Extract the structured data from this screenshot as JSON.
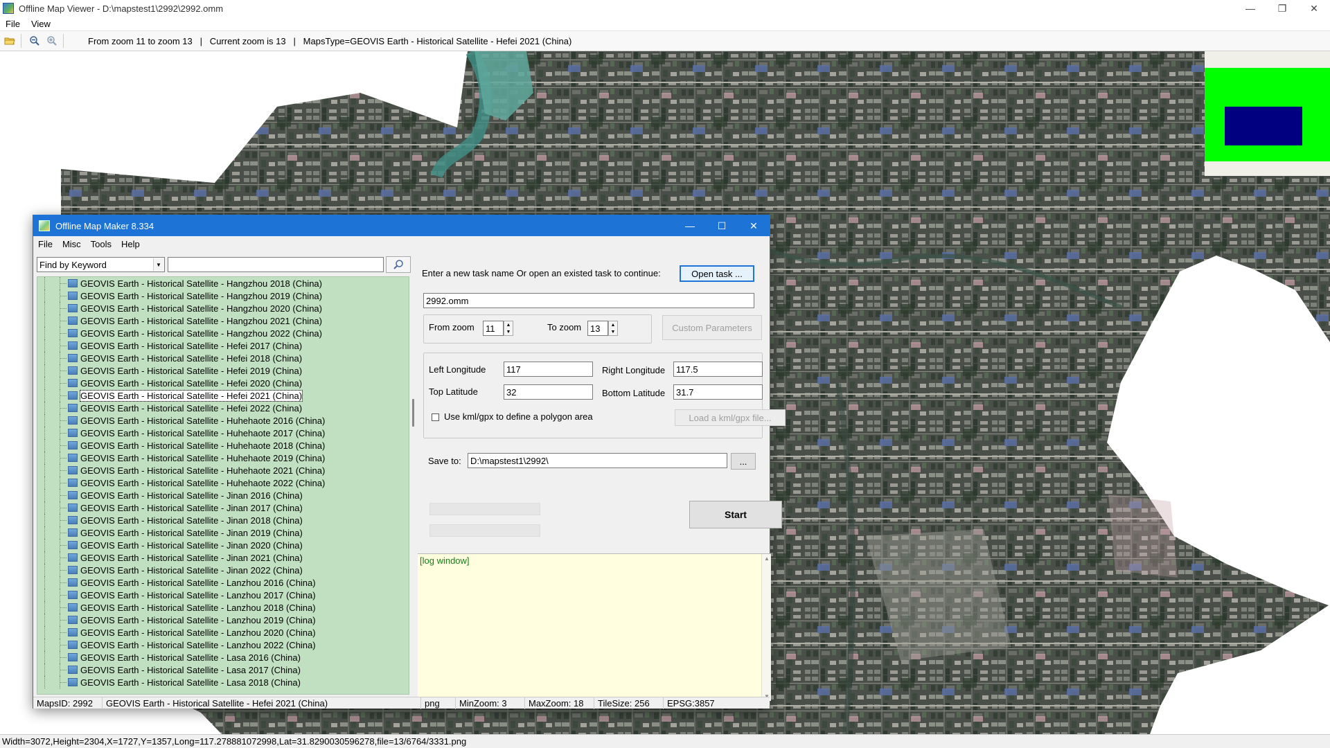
{
  "viewer": {
    "title": "Offline Map Viewer - D:\\mapstest1\\2992\\2992.omm",
    "window_controls": {
      "minimize": "—",
      "maximize": "❐",
      "close": "✕"
    },
    "menu": [
      "File",
      "View"
    ],
    "toolbar": {
      "status_text": "From zoom 11 to zoom 13   |   Current zoom is 13   |   MapsType=GEOVIS Earth - Historical Satellite - Hefei 2021 (China)",
      "icons": [
        "folder-open-icon",
        "zoom-out-icon",
        "zoom-in-icon"
      ]
    },
    "statusbar": "Width=3072,Height=2304,X=1727,Y=1357,Long=117.278881072998,Lat=31.8290030596278,file=13/6764/3331.png",
    "colors": {
      "overview_green": "#00ff00",
      "overview_blue": "#000080"
    }
  },
  "maker": {
    "title": "Offline Map Maker 8.334",
    "window_controls": {
      "minimize": "—",
      "maximize": "☐",
      "close": "✕"
    },
    "menu": [
      "File",
      "Misc",
      "Tools",
      "Help"
    ],
    "search": {
      "mode": "Find by Keyword",
      "query": ""
    },
    "tree_items": [
      "GEOVIS Earth - Historical Satellite - Hangzhou 2018 (China)",
      "GEOVIS Earth - Historical Satellite - Hangzhou 2019 (China)",
      "GEOVIS Earth - Historical Satellite - Hangzhou 2020 (China)",
      "GEOVIS Earth - Historical Satellite - Hangzhou 2021 (China)",
      "GEOVIS Earth - Historical Satellite - Hangzhou 2022 (China)",
      "GEOVIS Earth - Historical Satellite - Hefei 2017 (China)",
      "GEOVIS Earth - Historical Satellite - Hefei 2018 (China)",
      "GEOVIS Earth - Historical Satellite - Hefei 2019 (China)",
      "GEOVIS Earth - Historical Satellite - Hefei 2020 (China)",
      "GEOVIS Earth - Historical Satellite - Hefei 2021 (China)",
      "GEOVIS Earth - Historical Satellite - Hefei 2022 (China)",
      "GEOVIS Earth - Historical Satellite - Huhehaote 2016 (China)",
      "GEOVIS Earth - Historical Satellite - Huhehaote 2017 (China)",
      "GEOVIS Earth - Historical Satellite - Huhehaote 2018 (China)",
      "GEOVIS Earth - Historical Satellite - Huhehaote 2019 (China)",
      "GEOVIS Earth - Historical Satellite - Huhehaote 2021 (China)",
      "GEOVIS Earth - Historical Satellite - Huhehaote 2022 (China)",
      "GEOVIS Earth - Historical Satellite - Jinan 2016 (China)",
      "GEOVIS Earth - Historical Satellite - Jinan 2017 (China)",
      "GEOVIS Earth - Historical Satellite - Jinan 2018 (China)",
      "GEOVIS Earth - Historical Satellite - Jinan 2019 (China)",
      "GEOVIS Earth - Historical Satellite - Jinan 2020 (China)",
      "GEOVIS Earth - Historical Satellite - Jinan 2021 (China)",
      "GEOVIS Earth - Historical Satellite - Jinan 2022 (China)",
      "GEOVIS Earth - Historical Satellite - Lanzhou 2016 (China)",
      "GEOVIS Earth - Historical Satellite - Lanzhou 2017 (China)",
      "GEOVIS Earth - Historical Satellite - Lanzhou 2018 (China)",
      "GEOVIS Earth - Historical Satellite - Lanzhou 2019 (China)",
      "GEOVIS Earth - Historical Satellite - Lanzhou 2020 (China)",
      "GEOVIS Earth - Historical Satellite - Lanzhou 2022 (China)",
      "GEOVIS Earth - Historical Satellite - Lasa 2016 (China)",
      "GEOVIS Earth - Historical Satellite - Lasa 2017 (China)",
      "GEOVIS Earth - Historical Satellite - Lasa 2018 (China)"
    ],
    "selected_index": 9,
    "task": {
      "prompt": "Enter a new task name Or open an existed task to continue:",
      "open_button": "Open task ...",
      "name": "2992.omm"
    },
    "zoom": {
      "from_label": "From zoom",
      "from_value": "11",
      "to_label": "To zoom",
      "to_value": "13",
      "custom_button": "Custom Parameters"
    },
    "area": {
      "left_lon_label": "Left Longitude",
      "left_lon": "117",
      "right_lon_label": "Right Longitude",
      "right_lon": "117.5",
      "top_lat_label": "Top Latitude",
      "top_lat": "32",
      "bottom_lat_label": "Bottom Latitude",
      "bottom_lat": "31.7",
      "kml_label": "Use kml/gpx to define a polygon area",
      "kml_button": "Load a kml/gpx file..."
    },
    "save": {
      "label": "Save to:",
      "path": "D:\\mapstest1\\2992\\",
      "browse": "..."
    },
    "start_button": "Start",
    "log_text": "[log window]",
    "status": {
      "maps_id": "MapsID: 2992",
      "maps_name": "GEOVIS Earth - Historical Satellite - Hefei 2021 (China)",
      "format": "png",
      "min_zoom": "MinZoom: 3",
      "max_zoom": "MaxZoom: 18",
      "tile_size": "TileSize: 256",
      "epsg": "EPSG:3857"
    }
  }
}
